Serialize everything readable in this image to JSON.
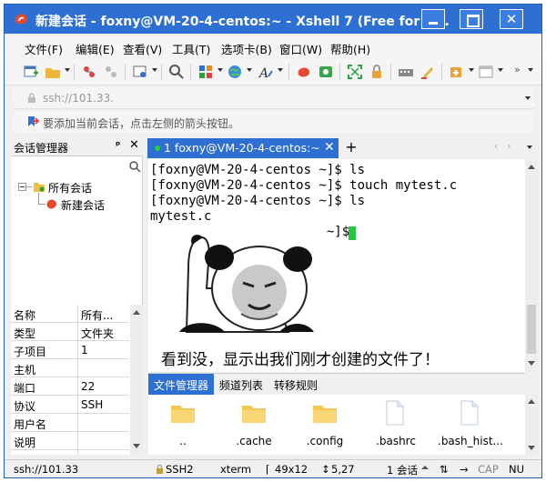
{
  "window": {
    "title": "新建会话 - foxny@VM-20-4-centos:~ - Xshell 7 (Free for H...",
    "close_glyph": "✕"
  },
  "menu": [
    "文件(F)",
    "编辑(E)",
    "查看(V)",
    "工具(T)",
    "选项卡(B)",
    "窗口(W)",
    "帮助(H)"
  ],
  "address": {
    "text": "ssh://101.33."
  },
  "hint": {
    "text": "要添加当前会话，点击左侧的箭头按钮。"
  },
  "session_manager": {
    "title": "会话管理器",
    "pin_glyph": "ᵖ",
    "close_glyph": "✕",
    "tree": {
      "root": "所有会话",
      "child": "新建会话"
    },
    "properties": [
      {
        "key": "名称",
        "value": "所有..."
      },
      {
        "key": "类型",
        "value": "文件夹"
      },
      {
        "key": "子项目",
        "value": "1"
      },
      {
        "key": "主机",
        "value": ""
      },
      {
        "key": "端口",
        "value": "22"
      },
      {
        "key": "协议",
        "value": "SSH"
      },
      {
        "key": "用户名",
        "value": ""
      },
      {
        "key": "说明",
        "value": ""
      }
    ]
  },
  "tab": {
    "label": "1 foxny@VM-20-4-centos:~",
    "close_glyph": "✕",
    "add_glyph": "+"
  },
  "terminal": {
    "lines": [
      "[foxny@VM-20-4-centos ~]$ ls",
      "[foxny@VM-20-4-centos ~]$ touch mytest.c",
      "[foxny@VM-20-4-centos ~]$ ls",
      "mytest.c",
      "                       ~]$ "
    ],
    "caption": "看到没，显示出我们刚才创建的文件了！",
    "cursor_color": "#23c83d"
  },
  "file_manager": {
    "tabs": [
      "文件管理器",
      "频道列表",
      "转移规则"
    ],
    "files": [
      ".",
      ".cache",
      ".config",
      ".bashrc",
      ".bash_hist..."
    ],
    "first_label": ".."
  },
  "status": {
    "address": "ssh://101.33",
    "protocol": "SSH2",
    "terminal": "xterm",
    "size": "49x12",
    "position": "5,27",
    "sessions": "1 会话",
    "cap": "CAP",
    "num": "NU"
  },
  "colors": {
    "accent": "#2d6fd2",
    "cursor": "#23c83d"
  }
}
